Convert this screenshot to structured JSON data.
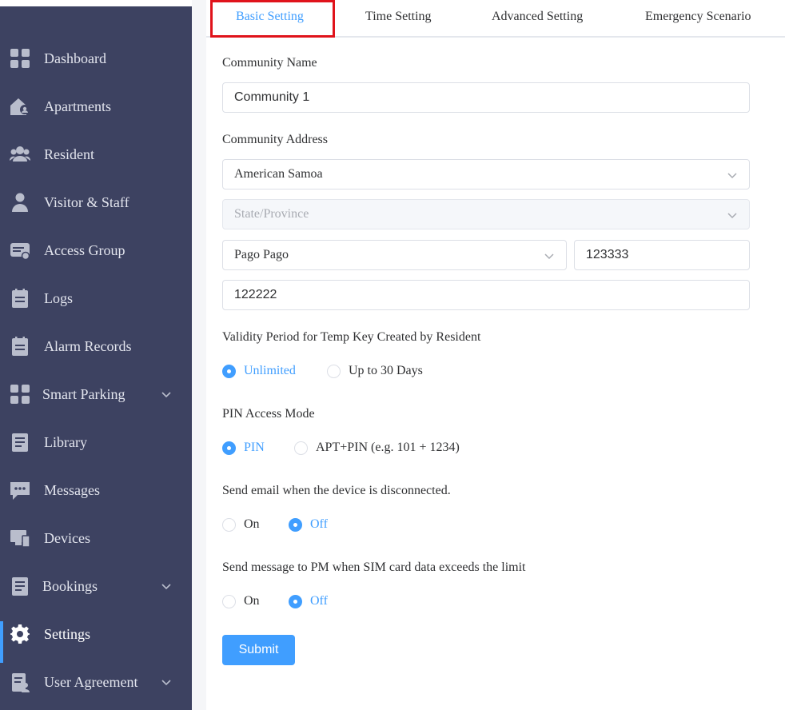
{
  "sidebar": {
    "items": [
      {
        "label": "Dashboard",
        "icon": "dashboard-icon"
      },
      {
        "label": "Apartments",
        "icon": "apartments-icon"
      },
      {
        "label": "Resident",
        "icon": "resident-icon"
      },
      {
        "label": "Visitor & Staff",
        "icon": "visitor-staff-icon"
      },
      {
        "label": "Access Group",
        "icon": "access-group-icon"
      },
      {
        "label": "Logs",
        "icon": "logs-icon"
      },
      {
        "label": "Alarm Records",
        "icon": "alarm-records-icon"
      },
      {
        "label": "Smart Parking",
        "icon": "smart-parking-icon",
        "expandable": true
      },
      {
        "label": "Library",
        "icon": "library-icon"
      },
      {
        "label": "Messages",
        "icon": "messages-icon"
      },
      {
        "label": "Devices",
        "icon": "devices-icon"
      },
      {
        "label": "Bookings",
        "icon": "bookings-icon",
        "expandable": true
      },
      {
        "label": "Settings",
        "icon": "settings-gear-icon",
        "active": true
      },
      {
        "label": "User Agreement",
        "icon": "user-agreement-icon",
        "expandable": true
      }
    ]
  },
  "tabs": [
    {
      "label": "Basic Setting",
      "active": true
    },
    {
      "label": "Time Setting"
    },
    {
      "label": "Advanced Setting"
    },
    {
      "label": "Emergency Scenario"
    }
  ],
  "form": {
    "community_name": {
      "label": "Community Name",
      "value": "Community 1"
    },
    "community_address": {
      "label": "Community Address",
      "country": "American Samoa",
      "state_placeholder": "State/Province",
      "city": "Pago Pago",
      "postal": "123333",
      "street": "122222"
    },
    "validity": {
      "label": "Validity Period for Temp Key Created by Resident",
      "options": [
        "Unlimited",
        "Up to 30 Days"
      ],
      "selected": "Unlimited"
    },
    "pin_mode": {
      "label": "PIN Access Mode",
      "options": [
        "PIN",
        "APT+PIN (e.g. 101 + 1234)"
      ],
      "selected": "PIN"
    },
    "email_disconnect": {
      "label": "Send email when the device is disconnected.",
      "options": [
        "On",
        "Off"
      ],
      "selected": "Off"
    },
    "sim_message": {
      "label": "Send message to PM when SIM card data exceeds the limit",
      "options": [
        "On",
        "Off"
      ],
      "selected": "Off"
    },
    "submit_label": "Submit"
  },
  "colors": {
    "sidebar_bg": "#3d4261",
    "accent": "#409eff",
    "highlight_box": "#e0131b"
  }
}
